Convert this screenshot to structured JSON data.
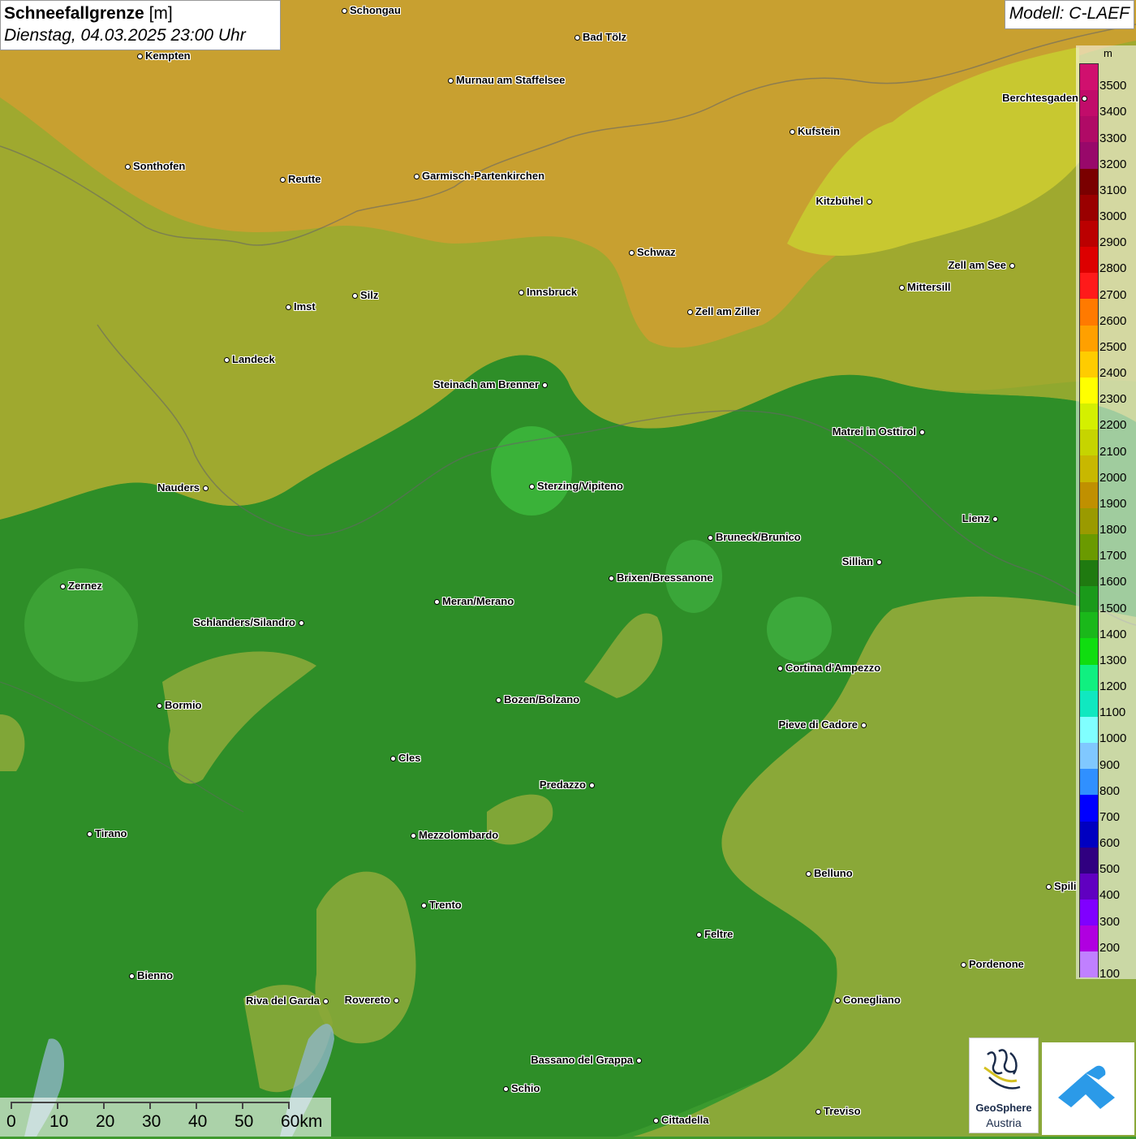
{
  "title": {
    "main": "Schneefallgrenze",
    "unit": "[m]",
    "datetime": "Dienstag, 04.03.2025 23:00 Uhr"
  },
  "model": "Modell: C-LAEF",
  "legend": {
    "unit": "m",
    "entries": [
      {
        "label": "3500",
        "color": "#d0106e"
      },
      {
        "label": "3400",
        "color": "#c10c6a"
      },
      {
        "label": "3300",
        "color": "#b00a66"
      },
      {
        "label": "3200",
        "color": "#98086a"
      },
      {
        "label": "3100",
        "color": "#7a0000"
      },
      {
        "label": "3000",
        "color": "#9a0000"
      },
      {
        "label": "2900",
        "color": "#bb0000"
      },
      {
        "label": "2800",
        "color": "#dd0000"
      },
      {
        "label": "2700",
        "color": "#ff1a1a"
      },
      {
        "label": "2600",
        "color": "#ff7a00"
      },
      {
        "label": "2500",
        "color": "#ffa000"
      },
      {
        "label": "2400",
        "color": "#ffcc00"
      },
      {
        "label": "2300",
        "color": "#ffff00"
      },
      {
        "label": "2200",
        "color": "#d4f000"
      },
      {
        "label": "2100",
        "color": "#c6d400"
      },
      {
        "label": "2000",
        "color": "#c8b800"
      },
      {
        "label": "1900",
        "color": "#c09000"
      },
      {
        "label": "1800",
        "color": "#9a9a00"
      },
      {
        "label": "1700",
        "color": "#6a9a00"
      },
      {
        "label": "1600",
        "color": "#1f7a10"
      },
      {
        "label": "1500",
        "color": "#1a9a1a"
      },
      {
        "label": "1400",
        "color": "#1ab81a"
      },
      {
        "label": "1300",
        "color": "#10dd10"
      },
      {
        "label": "1200",
        "color": "#10f080"
      },
      {
        "label": "1100",
        "color": "#10e8c0"
      },
      {
        "label": "1000",
        "color": "#80ffff"
      },
      {
        "label": "900",
        "color": "#80c8ff"
      },
      {
        "label": "800",
        "color": "#3090ff"
      },
      {
        "label": "700",
        "color": "#0000ff"
      },
      {
        "label": "600",
        "color": "#0000c0"
      },
      {
        "label": "500",
        "color": "#300080"
      },
      {
        "label": "400",
        "color": "#6000c0"
      },
      {
        "label": "300",
        "color": "#8000ff"
      },
      {
        "label": "200",
        "color": "#b000e0"
      },
      {
        "label": "100",
        "color": "#c080ff"
      }
    ]
  },
  "cities": [
    {
      "name": "Schongau"
    },
    {
      "name": "Kempten"
    },
    {
      "name": "Bad Tölz"
    },
    {
      "name": "Murnau am Staffelsee"
    },
    {
      "name": "Berchtesgaden"
    },
    {
      "name": "Kufstein"
    },
    {
      "name": "Sonthofen"
    },
    {
      "name": "Reutte"
    },
    {
      "name": "Garmisch-Partenkirchen"
    },
    {
      "name": "Kitzbühel"
    },
    {
      "name": "Schwaz"
    },
    {
      "name": "Zell am See"
    },
    {
      "name": "Innsbruck"
    },
    {
      "name": "Mittersill"
    },
    {
      "name": "Imst"
    },
    {
      "name": "Silz"
    },
    {
      "name": "Zell am Ziller"
    },
    {
      "name": "Landeck"
    },
    {
      "name": "Steinach am Brenner"
    },
    {
      "name": "Matrei in Osttirol"
    },
    {
      "name": "Nauders"
    },
    {
      "name": "Sterzing/Vipiteno"
    },
    {
      "name": "Lienz"
    },
    {
      "name": "Bruneck/Brunico"
    },
    {
      "name": "Sillian"
    },
    {
      "name": "Zernez"
    },
    {
      "name": "Brixen/Bressanone"
    },
    {
      "name": "Meran/Merano"
    },
    {
      "name": "Schlanders/Silandro"
    },
    {
      "name": "Cortina d'Ampezzo"
    },
    {
      "name": "Bozen/Bolzano"
    },
    {
      "name": "Bormio"
    },
    {
      "name": "Pieve di Cadore"
    },
    {
      "name": "Cles"
    },
    {
      "name": "Predazzo"
    },
    {
      "name": "Tirano"
    },
    {
      "name": "Mezzolombardo"
    },
    {
      "name": "Belluno"
    },
    {
      "name": "Spili"
    },
    {
      "name": "Trento"
    },
    {
      "name": "Feltre"
    },
    {
      "name": "Pordenone"
    },
    {
      "name": "Bienno"
    },
    {
      "name": "Riva del Garda"
    },
    {
      "name": "Rovereto"
    },
    {
      "name": "Conegliano"
    },
    {
      "name": "Bassano del Grappa"
    },
    {
      "name": "Schio"
    },
    {
      "name": "Treviso"
    },
    {
      "name": "Cittadella"
    }
  ],
  "scale": {
    "labels": [
      "0",
      "10",
      "20",
      "30",
      "40",
      "50",
      "60km"
    ]
  },
  "logo": {
    "line1": "GeoSphere",
    "line2": "Austria"
  }
}
